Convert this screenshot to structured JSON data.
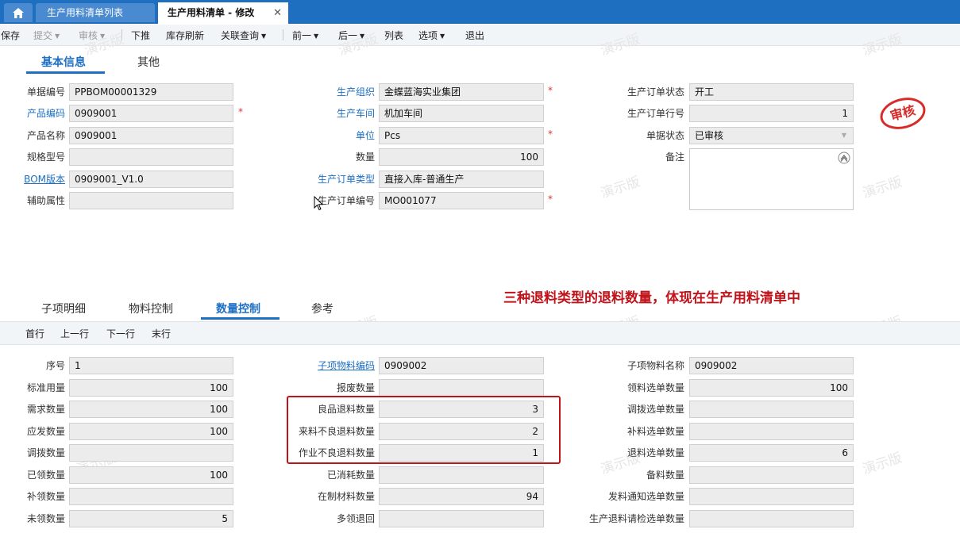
{
  "tabs": {
    "home_icon": "home-icon",
    "list_tab": "生产用料清单列表",
    "edit_tab": "生产用料清单 - 修改",
    "close_glyph": "✕"
  },
  "toolbar": {
    "save": "保存",
    "submit": "提交",
    "audit": "审核",
    "push_down": "下推",
    "refresh_stock": "库存刷新",
    "linked_query": "关联查询",
    "prev": "前一",
    "next": "后一",
    "list": "列表",
    "options": "选项",
    "exit": "退出"
  },
  "main_tabs": {
    "basic": "基本信息",
    "other": "其他"
  },
  "header": {
    "bill_no": {
      "label": "单据编号",
      "value": "PPBOM00001329"
    },
    "product_code": {
      "label": "产品编码",
      "value": "0909001"
    },
    "product_name": {
      "label": "产品名称",
      "value": "0909001"
    },
    "spec": {
      "label": "规格型号",
      "value": ""
    },
    "bom_version": {
      "label": "BOM版本",
      "value": "0909001_V1.0"
    },
    "aux_attr": {
      "label": "辅助属性",
      "value": ""
    },
    "prod_org": {
      "label": "生产组织",
      "value": "金蝶蓝海实业集团"
    },
    "workshop": {
      "label": "生产车间",
      "value": "机加车间"
    },
    "unit": {
      "label": "单位",
      "value": "Pcs"
    },
    "quantity": {
      "label": "数量",
      "value": "100"
    },
    "order_type": {
      "label": "生产订单类型",
      "value": "直接入库-普通生产"
    },
    "order_no": {
      "label": "生产订单编号",
      "value": "MO001077"
    },
    "order_status": {
      "label": "生产订单状态",
      "value": "开工"
    },
    "order_line": {
      "label": "生产订单行号",
      "value": "1"
    },
    "bill_status": {
      "label": "单据状态",
      "value": "已审核"
    },
    "remark": {
      "label": "备注",
      "value": ""
    },
    "stamp": "审核"
  },
  "required_mark": "*",
  "watermark": "演示版",
  "annotation": "三种退料类型的退料数量，体现在生产用料清单中",
  "detail_tabs": {
    "items": "子项明细",
    "material_ctrl": "物料控制",
    "qty_ctrl": "数量控制",
    "ref": "参考"
  },
  "detail_nav": {
    "first": "首行",
    "prev": "上一行",
    "next": "下一行",
    "last": "末行"
  },
  "detail": {
    "seq": {
      "label": "序号",
      "value": "1"
    },
    "std_qty": {
      "label": "标准用量",
      "value": "100"
    },
    "demand_qty": {
      "label": "需求数量",
      "value": "100"
    },
    "should_issue": {
      "label": "应发数量",
      "value": "100"
    },
    "transfer_qty": {
      "label": "调拨数量",
      "value": ""
    },
    "picked_qty": {
      "label": "已领数量",
      "value": "100"
    },
    "replenish_qty": {
      "label": "补领数量",
      "value": ""
    },
    "unpicked_qty": {
      "label": "未领数量",
      "value": "5"
    },
    "child_code": {
      "label": "子项物料编码",
      "value": "0909002"
    },
    "scrap_qty": {
      "label": "报废数量",
      "value": ""
    },
    "good_return": {
      "label": "良品退料数量",
      "value": "3"
    },
    "incoming_bad_return": {
      "label": "来料不良退料数量",
      "value": "2"
    },
    "process_bad_return": {
      "label": "作业不良退料数量",
      "value": "1"
    },
    "consumed_qty": {
      "label": "已消耗数量",
      "value": ""
    },
    "wip_qty": {
      "label": "在制材料数量",
      "value": "94"
    },
    "over_return": {
      "label": "多领退回",
      "value": ""
    },
    "child_name": {
      "label": "子项物料名称",
      "value": "0909002"
    },
    "pick_sel_qty": {
      "label": "领料选单数量",
      "value": "100"
    },
    "transfer_sel_qty": {
      "label": "调拨选单数量",
      "value": ""
    },
    "replenish_sel_qty": {
      "label": "补料选单数量",
      "value": ""
    },
    "return_sel_qty": {
      "label": "退料选单数量",
      "value": "6"
    },
    "reserve_qty": {
      "label": "备料数量",
      "value": ""
    },
    "issue_notice_sel": {
      "label": "发料通知选单数量",
      "value": ""
    },
    "return_inspect_sel": {
      "label": "生产退料请检选单数量",
      "value": ""
    }
  }
}
